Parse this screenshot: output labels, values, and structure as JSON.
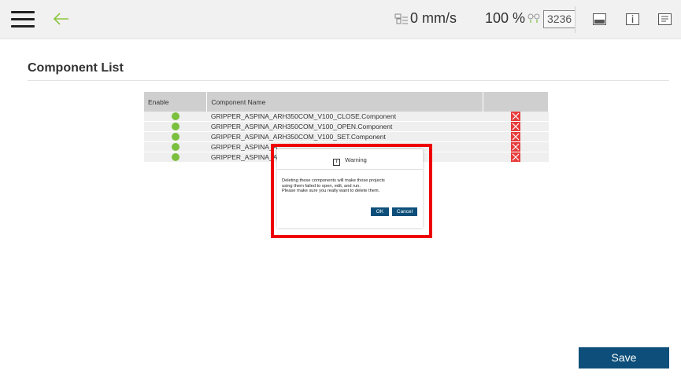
{
  "header": {
    "speed": "0 mm/s",
    "speed_percent": "100 %",
    "counter": "3236"
  },
  "icons": {
    "menu": "hamburger-menu-icon",
    "back": "back-arrow-icon",
    "speed": "robot-speed-icon",
    "link": "connection-icon",
    "display": "display-icon",
    "info": "info-icon",
    "document": "document-icon"
  },
  "page": {
    "title": "Component List"
  },
  "table": {
    "headers": [
      "Enable",
      "Component Name",
      ""
    ],
    "rows": [
      {
        "name": "GRIPPER_ASPINA_ARH350COM_V100_CLOSE.Component"
      },
      {
        "name": "GRIPPER_ASPINA_ARH350COM_V100_OPEN.Component"
      },
      {
        "name": "GRIPPER_ASPINA_ARH350COM_V100_SET.Component"
      },
      {
        "name": "GRIPPER_ASPINA_A"
      },
      {
        "name": "GRIPPER_ASPINA_A"
      }
    ]
  },
  "dialog": {
    "title": "Warning",
    "info_glyph": "i",
    "message_line1": "Deleting these components will make those projects",
    "message_line2": "using them failed to open, edit, and run.",
    "message_line3": "Please make sure you really want to delete them.",
    "ok_label": "OK",
    "cancel_label": "Cancel"
  },
  "footer": {
    "save_label": "Save"
  },
  "colors": {
    "accent": "#0d4f7a",
    "enabled": "#7bbf3e",
    "delete": "#e73c3c",
    "highlight": "#ee0000",
    "back_arrow": "#8cc63f"
  }
}
